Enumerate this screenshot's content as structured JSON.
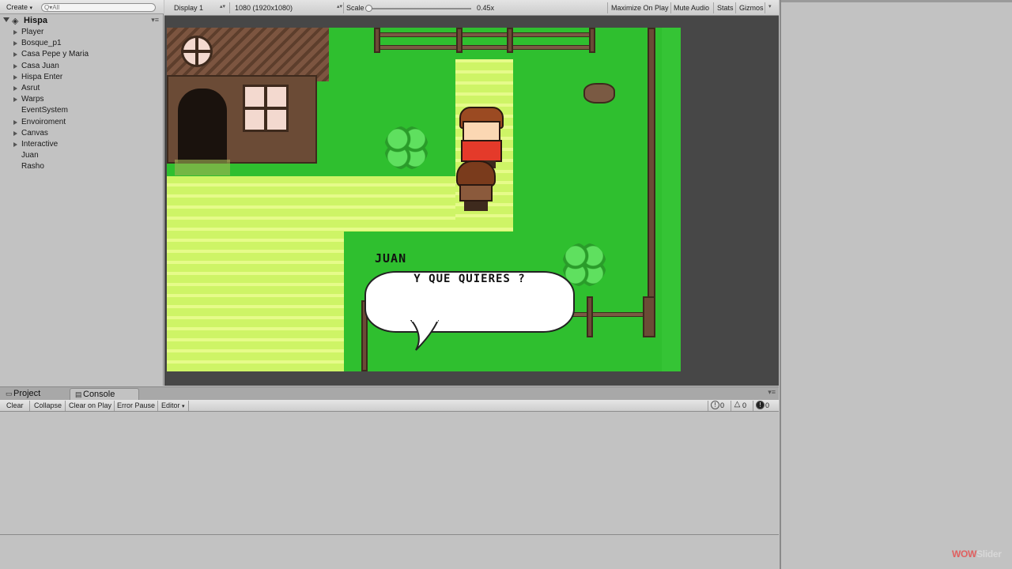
{
  "hierarchy": {
    "create_label": "Create",
    "search_placeholder": "Q▾All",
    "scene_name": "Hispa",
    "items": [
      {
        "label": "Player",
        "expandable": true
      },
      {
        "label": "Bosque_p1",
        "expandable": true
      },
      {
        "label": "Casa Pepe y Maria",
        "expandable": true
      },
      {
        "label": "Casa Juan",
        "expandable": true
      },
      {
        "label": "Hispa Enter",
        "expandable": true
      },
      {
        "label": "Asrut",
        "expandable": true
      },
      {
        "label": "Warps",
        "expandable": true
      },
      {
        "label": "EventSystem",
        "expandable": false
      },
      {
        "label": "Envoiroment",
        "expandable": true
      },
      {
        "label": "Canvas",
        "expandable": true
      },
      {
        "label": "Interactive",
        "expandable": true
      },
      {
        "label": "Juan",
        "expandable": false
      },
      {
        "label": "Rasho",
        "expandable": false
      }
    ]
  },
  "game_toolbar": {
    "display": "Display 1",
    "resolution": "1080 (1920x1080)",
    "scale_label": "Scale",
    "scale_value": "0.45x",
    "scale_fraction": 0.0,
    "maximize_on_play": "Maximize On Play",
    "mute_audio": "Mute Audio",
    "stats": "Stats",
    "gizmos": "Gizmos"
  },
  "game": {
    "speaker": "JUAN",
    "dialogue": "Y QUE QUIERES ?"
  },
  "console": {
    "tabs": [
      {
        "label": "Project",
        "icon": "folder-icon"
      },
      {
        "label": "Console",
        "icon": "console-icon"
      }
    ],
    "buttons": {
      "clear": "Clear",
      "collapse": "Collapse",
      "clear_on_play": "Clear on Play",
      "error_pause": "Error Pause",
      "editor": "Editor"
    },
    "counts": {
      "info": "0",
      "warnings": "0",
      "errors": "0"
    }
  },
  "watermark": {
    "prefix": "WOW",
    "suffix": "Slider"
  },
  "colors": {
    "grass": "#2fbf2f",
    "path": "#cef466",
    "editor_bg": "#c2c2c2"
  }
}
